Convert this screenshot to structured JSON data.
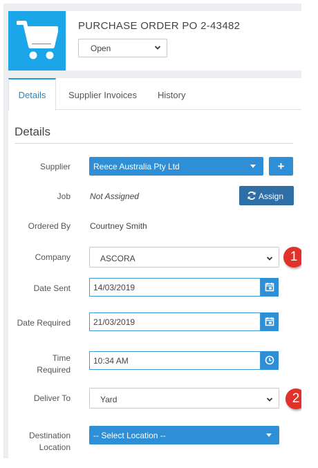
{
  "header": {
    "title": "PURCHASE ORDER PO 2-43482",
    "status": "Open"
  },
  "tabs": [
    {
      "label": "Details"
    },
    {
      "label": "Supplier Invoices"
    },
    {
      "label": "History"
    }
  ],
  "section_title": "Details",
  "fields": {
    "supplier": {
      "label": "Supplier",
      "value": "Reece Australia Pty Ltd",
      "add_label": "+"
    },
    "job": {
      "label": "Job",
      "value": "Not Assigned",
      "assign_label": "Assign"
    },
    "ordered_by": {
      "label": "Ordered By",
      "value": "Courtney Smith"
    },
    "company": {
      "label": "Company",
      "value": "ASCORA"
    },
    "date_sent": {
      "label": "Date Sent",
      "value": "14/03/2019"
    },
    "date_required": {
      "label": "Date Required",
      "value": "21/03/2019"
    },
    "time_required": {
      "label_line1": "Time",
      "label_line2": "Required",
      "value": "10:34 AM"
    },
    "deliver_to": {
      "label": "Deliver To",
      "value": "Yard"
    },
    "destination_location": {
      "label_line1": "Destination",
      "label_line2": "Location",
      "placeholder": "-- Select Location --"
    }
  },
  "callouts": [
    "1",
    "2"
  ],
  "colors": {
    "brand_blue": "#1aa6e8",
    "button_blue": "#2f8fd6",
    "callout_red": "#e0312b"
  }
}
